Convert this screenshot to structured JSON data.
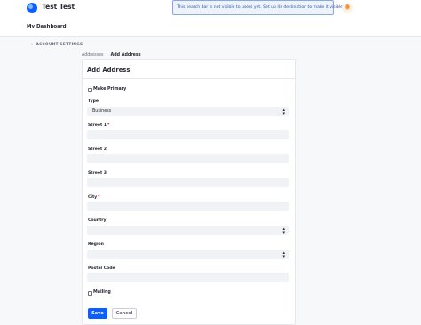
{
  "header": {
    "site_name": "Test Test",
    "search_notice": "This search bar is not visible to users yet. Set up its destination to make it visible.",
    "user_icon": "user-icon"
  },
  "dashboard": {
    "title": "My Dashboard"
  },
  "nav": {
    "back_label": "ACCOUNT SETTINGS",
    "back_icon": "chevron-left-icon"
  },
  "breadcrumb": {
    "parent": "Addresses",
    "separator": "›",
    "current": "Add Address"
  },
  "form": {
    "title": "Add Address",
    "make_primary": {
      "label": "Make Primary",
      "checked": false
    },
    "type": {
      "label": "Type",
      "value": "Business",
      "options": [
        "Business"
      ]
    },
    "street1": {
      "label": "Street 1",
      "required_marker": "*",
      "value": ""
    },
    "street2": {
      "label": "Street 2",
      "value": ""
    },
    "street3": {
      "label": "Street 3",
      "value": ""
    },
    "city": {
      "label": "City",
      "required_marker": "*",
      "value": ""
    },
    "country": {
      "label": "Country",
      "value": ""
    },
    "region": {
      "label": "Region",
      "value": ""
    },
    "postal_code": {
      "label": "Postal Code",
      "value": ""
    },
    "mailing": {
      "label": "Mailing",
      "checked": false
    },
    "save_label": "Save",
    "cancel_label": "Cancel"
  },
  "colors": {
    "primary": "#0b5fff",
    "required": "#da1414",
    "field_bg": "#f1f2f5"
  }
}
